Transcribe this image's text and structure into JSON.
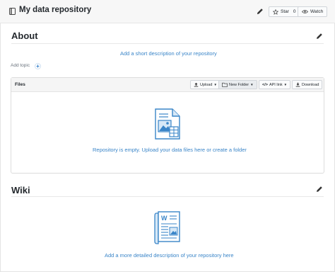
{
  "repo": {
    "title": "My data repository",
    "star_label": "Star",
    "star_count": "0",
    "watch_label": "Watch"
  },
  "about": {
    "title": "About",
    "description_link": "Add a short description of your repository",
    "add_topic_label": "Add topic",
    "add_topic_symbol": "+"
  },
  "files": {
    "title": "Files",
    "buttons": {
      "upload": "Upload",
      "new_folder": "New Folder",
      "api_link": "API link",
      "download": "Download"
    },
    "empty_message": "Repository is empty. Upload your data files here or create a folder"
  },
  "wiki": {
    "title": "Wiki",
    "description_link": "Add a more detailed description of your repository here"
  },
  "colors": {
    "link": "#3a85c8",
    "icon_blue": "#3a85c8",
    "icon_light": "#d6e8f7"
  }
}
